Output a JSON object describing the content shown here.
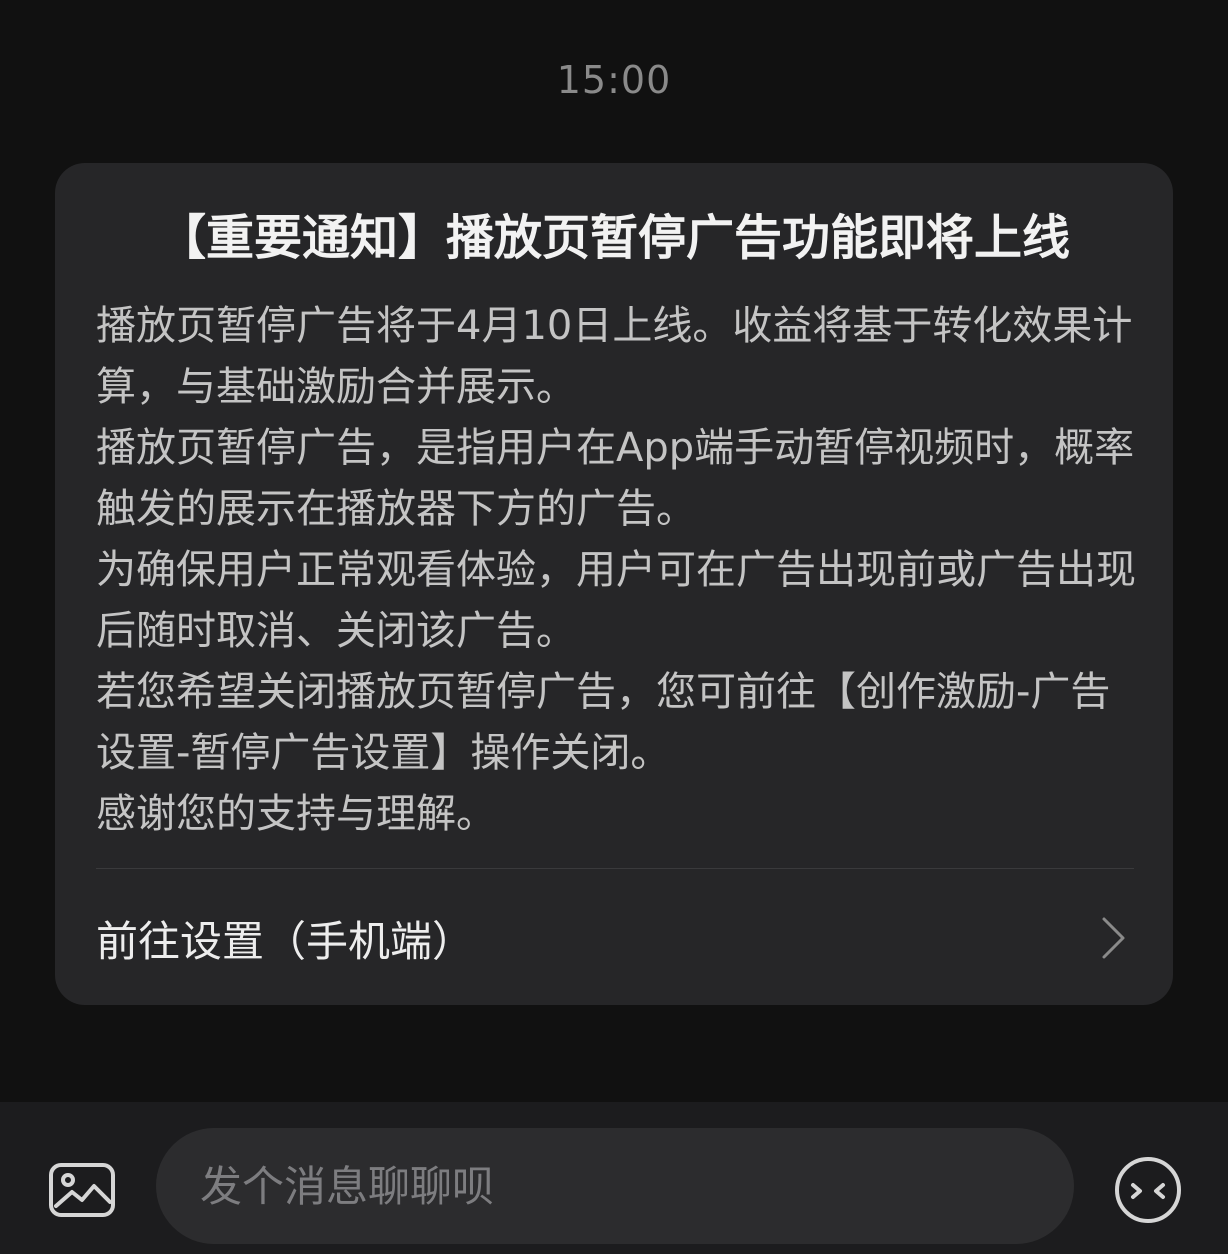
{
  "chat": {
    "timestamp": "15:00"
  },
  "notice": {
    "title": "【重要通知】播放页暂停广告功能即将上线",
    "paragraphs": [
      "播放页暂停广告将于4月10日上线。收益将基于转化效果计算，与基础激励合并展示。",
      "播放页暂停广告，是指用户在App端手动暂停视频时，概率触发的展示在播放器下方的广告。",
      "为确保用户正常观看体验，用户可在广告出现前或广告出现后随时取消、关闭该广告。",
      "若您希望关闭播放页暂停广告，您可前往【创作激励-广告设置-暂停广告设置】操作关闭。",
      "感谢您的支持与理解。"
    ],
    "action_label": "前往设置（手机端）",
    "action_icon": "chevron-right-icon"
  },
  "composer": {
    "placeholder": "发个消息聊聊呗",
    "image_icon": "image-icon",
    "emoji_icon": "emoji-icon"
  },
  "colors": {
    "background": "#111111",
    "card": "#262628",
    "bottom_bar": "#1c1c1e",
    "input": "#2c2c2e"
  }
}
